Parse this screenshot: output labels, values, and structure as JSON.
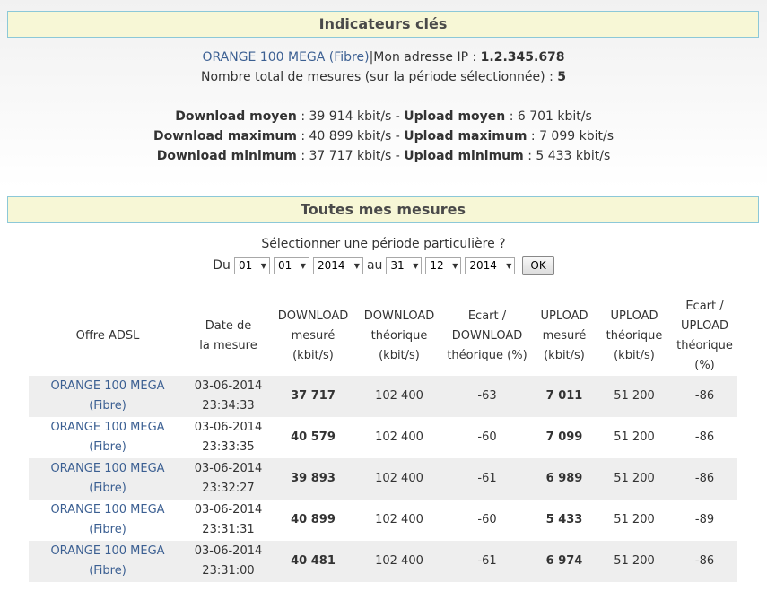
{
  "indicators": {
    "title": "Indicateurs clés",
    "offer_link": "ORANGE 100 MEGA (Fibre)",
    "ip_label": "|Mon adresse IP : ",
    "ip_value": "1.2.345.678",
    "total_label": "Nombre total de mesures (sur la période sélectionnée) : ",
    "total_value": "5",
    "dl_avg_label": "Download moyen",
    "dl_avg_value": " : 39 914 kbit/s - ",
    "ul_avg_label": "Upload moyen",
    "ul_avg_value": " : 6 701 kbit/s",
    "dl_max_label": "Download maximum",
    "dl_max_value": " : 40 899 kbit/s - ",
    "ul_max_label": "Upload maximum",
    "ul_max_value": " : 7 099 kbit/s",
    "dl_min_label": "Download minimum",
    "dl_min_value": " : 37 717 kbit/s - ",
    "ul_min_label": "Upload minimum",
    "ul_min_value": " : 5 433 kbit/s"
  },
  "measures": {
    "title": "Toutes mes mesures",
    "period_prompt": "Sélectionner une période particulière ?",
    "from_label": "Du",
    "to_label": "au",
    "from": {
      "day": "01",
      "month": "01",
      "year": "2014"
    },
    "to": {
      "day": "31",
      "month": "12",
      "year": "2014"
    },
    "ok_label": "OK"
  },
  "table": {
    "headers": [
      [
        "Offre ADSL"
      ],
      [
        "Date de",
        "la mesure"
      ],
      [
        "DOWNLOAD",
        "mesuré",
        "(kbit/s)"
      ],
      [
        "DOWNLOAD",
        "théorique",
        "(kbit/s)"
      ],
      [
        "Ecart /",
        "DOWNLOAD",
        "théorique (%)"
      ],
      [
        "UPLOAD",
        "mesuré",
        "(kbit/s)"
      ],
      [
        "UPLOAD",
        "théorique",
        "(kbit/s)"
      ],
      [
        "Ecart /",
        "UPLOAD",
        "théorique",
        "(%)"
      ]
    ],
    "rows": [
      {
        "offer1": "ORANGE 100 MEGA",
        "offer2": "(Fibre)",
        "date": "03-06-2014",
        "time": "23:34:33",
        "dl": "37 717",
        "dl_th": "102 400",
        "dl_gap": "-63",
        "ul": "7 011",
        "ul_th": "51 200",
        "ul_gap": "-86"
      },
      {
        "offer1": "ORANGE 100 MEGA",
        "offer2": "(Fibre)",
        "date": "03-06-2014",
        "time": "23:33:35",
        "dl": "40 579",
        "dl_th": "102 400",
        "dl_gap": "-60",
        "ul": "7 099",
        "ul_th": "51 200",
        "ul_gap": "-86"
      },
      {
        "offer1": "ORANGE 100 MEGA",
        "offer2": "(Fibre)",
        "date": "03-06-2014",
        "time": "23:32:27",
        "dl": "39 893",
        "dl_th": "102 400",
        "dl_gap": "-61",
        "ul": "6 989",
        "ul_th": "51 200",
        "ul_gap": "-86"
      },
      {
        "offer1": "ORANGE 100 MEGA",
        "offer2": "(Fibre)",
        "date": "03-06-2014",
        "time": "23:31:31",
        "dl": "40 899",
        "dl_th": "102 400",
        "dl_gap": "-60",
        "ul": "5 433",
        "ul_th": "51 200",
        "ul_gap": "-89"
      },
      {
        "offer1": "ORANGE 100 MEGA",
        "offer2": "(Fibre)",
        "date": "03-06-2014",
        "time": "23:31:00",
        "dl": "40 481",
        "dl_th": "102 400",
        "dl_gap": "-61",
        "ul": "6 974",
        "ul_th": "51 200",
        "ul_gap": "-86"
      }
    ]
  }
}
